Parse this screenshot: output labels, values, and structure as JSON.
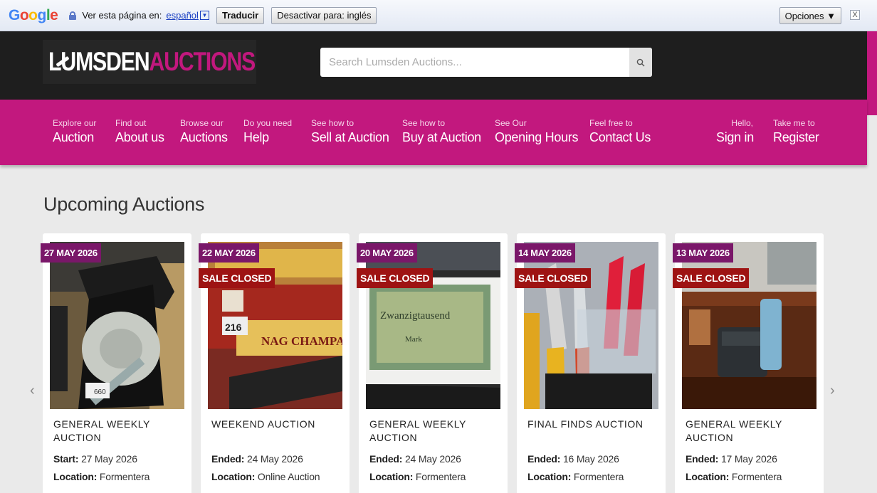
{
  "translate_bar": {
    "logo": "Google",
    "prompt": "Ver esta página en:",
    "language": "español",
    "translate_button": "Traducir",
    "disable_button": "Desactivar para: inglés",
    "options_button": "Opciones ▼",
    "close": "X"
  },
  "header": {
    "logo_part1": "LUMSDEN",
    "logo_part2": "AUCTIONS",
    "search_placeholder": "Search Lumsden Auctions..."
  },
  "nav": {
    "items": [
      {
        "small": "Explore our",
        "big": "Auction"
      },
      {
        "small": "Find out",
        "big": "About us"
      },
      {
        "small": "Browse our",
        "big": "Auctions"
      },
      {
        "small": "Do you need",
        "big": "Help"
      },
      {
        "small": "See how to",
        "big": "Sell at Auction"
      },
      {
        "small": "See how to",
        "big": "Buy at Auction"
      },
      {
        "small": "See Our",
        "big": "Opening Hours"
      },
      {
        "small": "Feel free to",
        "big": "Contact Us"
      }
    ],
    "account": [
      {
        "small": "Hello,",
        "big": "Sign in"
      },
      {
        "small": "Take me to",
        "big": "Register"
      }
    ]
  },
  "main": {
    "title": "Upcoming Auctions",
    "prev_arrow": "‹",
    "next_arrow": "›",
    "cards": [
      {
        "date": "27 MAY 2026",
        "status": "",
        "title": "GENERAL WEEKLY AUCTION",
        "date_label": "Start:",
        "date_value": "27 May 2026",
        "location_label": "Location:",
        "location_value": "Formentera"
      },
      {
        "date": "22 MAY 2026",
        "status": "SALE CLOSED",
        "title": "WEEKEND AUCTION",
        "date_label": "Ended:",
        "date_value": "24 May 2026",
        "location_label": "Location:",
        "location_value": "Online Auction"
      },
      {
        "date": "20 MAY 2026",
        "status": "SALE CLOSED",
        "title": "GENERAL WEEKLY AUCTION",
        "date_label": "Ended:",
        "date_value": "24 May 2026",
        "location_label": "Location:",
        "location_value": "Formentera"
      },
      {
        "date": "14 MAY 2026",
        "status": "SALE CLOSED",
        "title": "FINAL FINDS AUCTION",
        "date_label": "Ended:",
        "date_value": "16 May 2026",
        "location_label": "Location:",
        "location_value": "Formentera"
      },
      {
        "date": "13 MAY 2026",
        "status": "SALE CLOSED",
        "title": "GENERAL WEEKLY AUCTION",
        "date_label": "Ended:",
        "date_value": "17 May 2026",
        "location_label": "Location:",
        "location_value": "Formentera"
      }
    ]
  },
  "colors": {
    "brand_pink": "#c2187e",
    "date_badge": "#7a1769",
    "closed_badge": "#9e1313",
    "header_bg": "#1e1e1e"
  }
}
